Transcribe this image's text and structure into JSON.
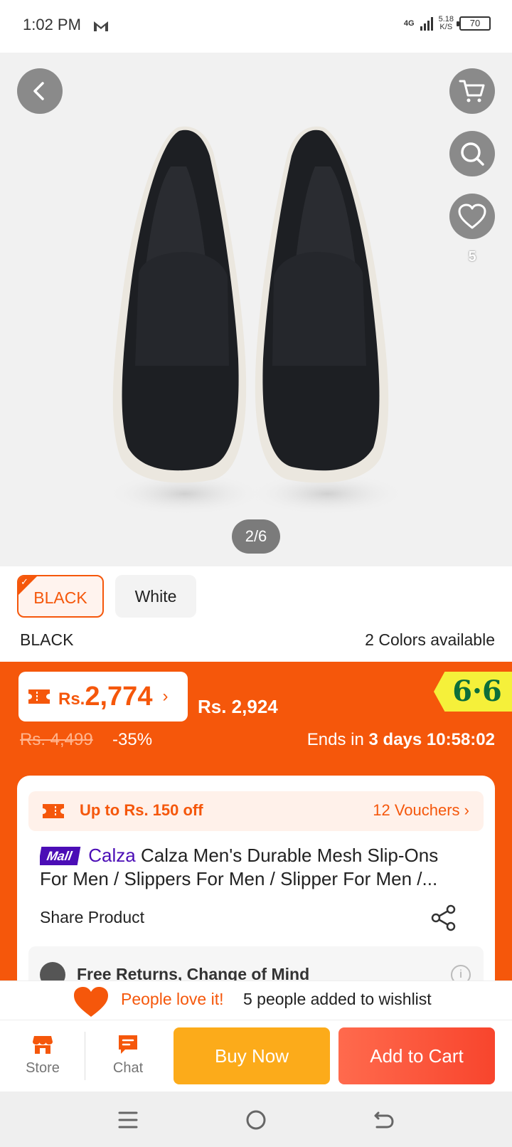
{
  "status_bar": {
    "time": "1:02 PM",
    "network": "4G",
    "speed_value": "5.18",
    "speed_unit": "K/S",
    "battery": "70"
  },
  "gallery": {
    "counter": "2/6",
    "wishlist_count": "5",
    "icons": [
      "back-icon",
      "cart-icon",
      "search-icon",
      "heart-icon"
    ]
  },
  "variants": {
    "options": [
      "BLACK",
      "White"
    ],
    "selected": "BLACK",
    "available_text": "2 Colors available"
  },
  "price": {
    "currency_prefix": "Rs.",
    "voucher_price": "2,774",
    "alt_price": "Rs. 2,924",
    "original_price": "Rs. 4,499",
    "discount": "-35%",
    "campaign_badge": "6·6",
    "ends_prefix": "Ends in",
    "ends_days": "3 days",
    "ends_time": "10:58:02"
  },
  "voucher": {
    "text": "Up to Rs. 150 off",
    "count": "12 Vouchers"
  },
  "product": {
    "mall_badge": "Mall",
    "brand": "Calza",
    "title": "Calza Men's Durable Mesh Slip-Ons For Men / Slippers For Men / Slipper For Men /...",
    "share_label": "Share Product",
    "returns_label": "Free Returns, Change of Mind"
  },
  "wishlist_banner": {
    "love_text": "People love it!",
    "added_text": "5 people added to wishlist"
  },
  "action_bar": {
    "store_label": "Store",
    "chat_label": "Chat",
    "buy_now": "Buy Now",
    "add_to_cart": "Add to Cart"
  },
  "colors": {
    "brand_orange": "#f5570b",
    "buy_now": "#fcab1a",
    "add_to_cart": "#f8452d",
    "mall_purple": "#4b0db6",
    "badge_yellow": "#f5f03a"
  }
}
